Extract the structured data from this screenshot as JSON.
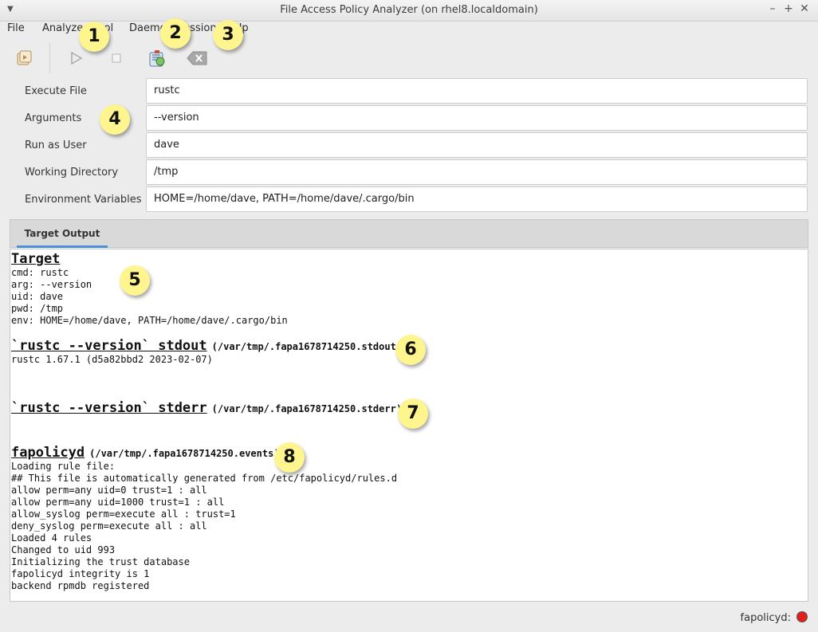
{
  "window": {
    "title": "File Access Policy Analyzer (on rhel8.localdomain)"
  },
  "menubar": {
    "file": "File",
    "analyze": "Analyze",
    "tail": "Tool",
    "daemon": "Daemon",
    "session": "Session",
    "help": "Help"
  },
  "toolbar": {
    "icons": [
      "open-session-icon",
      "play-icon",
      "stop-icon",
      "analyze-icon",
      "clear-icon"
    ]
  },
  "form": {
    "execute_file": {
      "label": "Execute File",
      "value": "rustc"
    },
    "arguments": {
      "label": "Arguments",
      "value": "--version"
    },
    "run_as_user": {
      "label": "Run as User",
      "value": "dave"
    },
    "working_directory": {
      "label": "Working Directory",
      "value": "/tmp"
    },
    "environment_variables": {
      "label": "Environment Variables",
      "value": "HOME=/home/dave, PATH=/home/dave/.cargo/bin"
    }
  },
  "tabs": {
    "target_output": "Target Output"
  },
  "output": {
    "target": {
      "heading": "Target",
      "lines": [
        "cmd: rustc",
        "arg: --version",
        "uid: dave",
        "pwd: /tmp",
        "env: HOME=/home/dave, PATH=/home/dave/.cargo/bin"
      ]
    },
    "stdout": {
      "heading": "`rustc --version` stdout",
      "path": "(/var/tmp/.fapa1678714250.stdout)",
      "lines": [
        "rustc 1.67.1 (d5a82bbd2 2023-02-07)"
      ]
    },
    "stderr": {
      "heading": "`rustc --version` stderr",
      "path": "(/var/tmp/.fapa1678714250.stderr)",
      "lines": []
    },
    "fapolicyd": {
      "heading": "fapolicyd",
      "path": "(/var/tmp/.fapa1678714250.events)",
      "lines": [
        "Loading rule file:",
        "## This file is automatically generated from /etc/fapolicyd/rules.d",
        "allow perm=any uid=0 trust=1 : all",
        "allow perm=any uid=1000 trust=1 : all",
        "allow_syslog perm=execute all : trust=1",
        "deny_syslog perm=execute all : all",
        "Loaded 4 rules",
        "Changed to uid 993",
        "Initializing the trust database",
        "fapolicyd integrity is 1",
        "backend rpmdb registered"
      ]
    }
  },
  "statusbar": {
    "daemon_label": "fapolicyd:",
    "daemon_status_color": "#e0211b"
  },
  "callouts": [
    "1",
    "2",
    "3",
    "4",
    "5",
    "6",
    "7",
    "8"
  ]
}
